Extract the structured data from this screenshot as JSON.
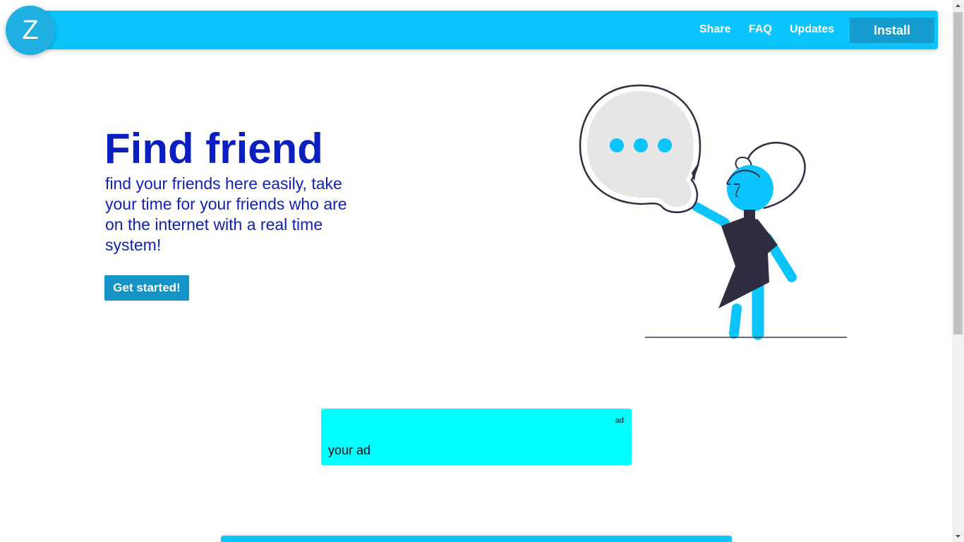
{
  "header": {
    "logo_letter": "Z",
    "nav": [
      {
        "label": "Share"
      },
      {
        "label": "FAQ"
      },
      {
        "label": "Updates"
      }
    ],
    "install_label": "Install"
  },
  "hero": {
    "title": "Find friend",
    "description": "find your friends here easily, take your time for your friends who are on the internet with a real time system!",
    "cta_label": "Get started!"
  },
  "ad": {
    "tag": "ad",
    "text": "your ad"
  },
  "colors": {
    "accent": "#0bc4fb",
    "title": "#0b1fc0",
    "button": "#1494c6",
    "ad_background": "#00ffff"
  }
}
